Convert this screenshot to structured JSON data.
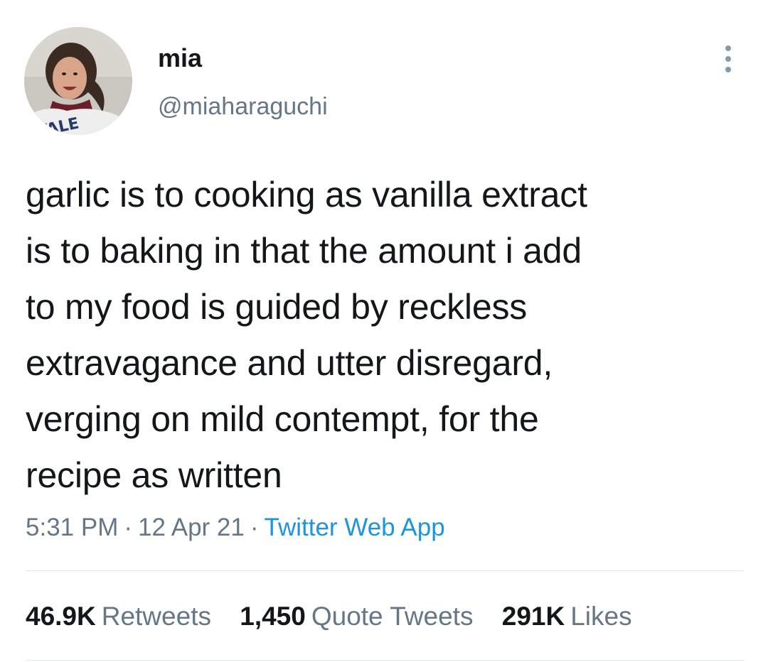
{
  "author": {
    "name": "mia",
    "handle": "@miaharaguchi",
    "avatar_icon": "profile-photo"
  },
  "menu": {
    "icon": "more-vertical-icon"
  },
  "tweet": {
    "text": "garlic is to cooking as vanilla extract\nis to baking in that the amount i add\nto my food is guided by reckless\nextravagance and utter disregard,\nverging on mild contempt, for the\nrecipe as written",
    "time": "5:31 PM",
    "separator": "·",
    "date": "12 Apr 21",
    "source": "Twitter Web App"
  },
  "stats": {
    "retweets": {
      "count": "46.9K",
      "label": "Retweets"
    },
    "quotes": {
      "count": "1,450",
      "label": "Quote Tweets"
    },
    "likes": {
      "count": "291K",
      "label": "Likes"
    }
  },
  "colors": {
    "text": "#14171a",
    "secondary": "#657786",
    "link": "#1b95e0",
    "divider": "#e1e8ed"
  }
}
